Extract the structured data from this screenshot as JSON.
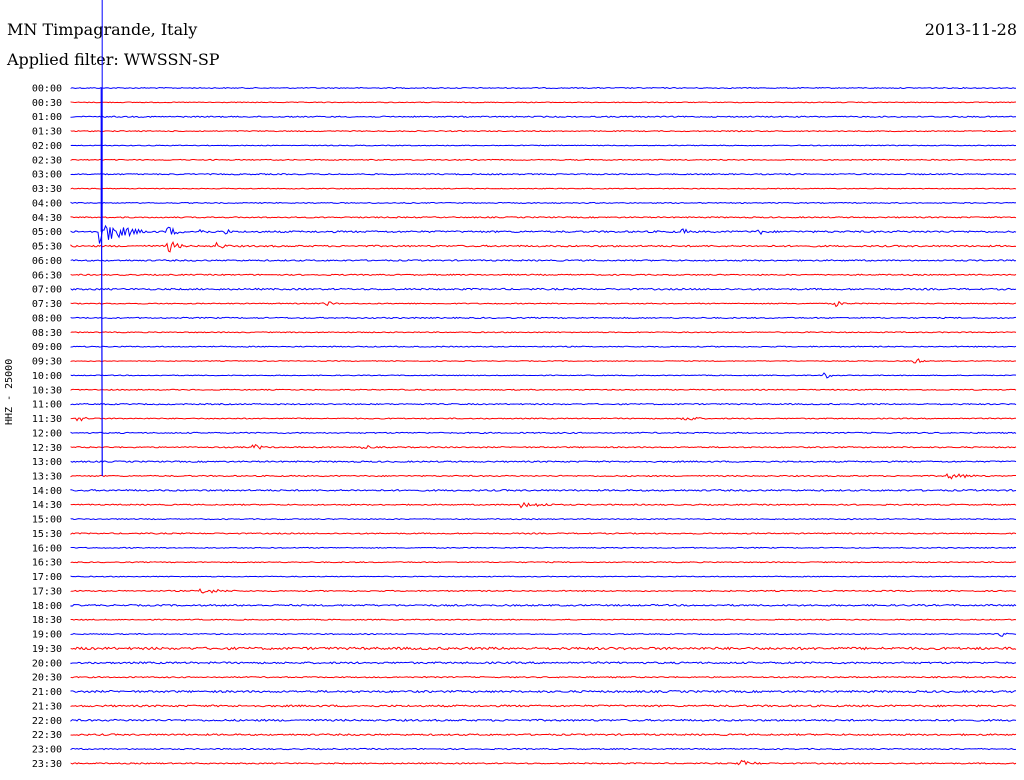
{
  "header": {
    "title": "MN Timpagrande, Italy",
    "date": "2013-11-28",
    "filter": "Applied filter: WWSSN-SP"
  },
  "colors": {
    "blue": "#0000ff",
    "red": "#ff0000",
    "text": "#000000"
  },
  "chart_data": {
    "type": "line",
    "title": "MN Timpagrande, Italy",
    "ylabel": "HHZ - 25000",
    "xlabel": "",
    "ylim": [
      "00:00",
      "23:30"
    ],
    "grid": false,
    "legend": "none",
    "row_labels": [
      "00:00",
      "00:30",
      "01:00",
      "01:30",
      "02:00",
      "02:30",
      "03:00",
      "03:30",
      "04:00",
      "04:30",
      "05:00",
      "05:30",
      "06:00",
      "06:30",
      "07:00",
      "07:30",
      "08:00",
      "08:30",
      "09:00",
      "09:30",
      "10:00",
      "10:30",
      "11:00",
      "11:30",
      "12:00",
      "12:30",
      "13:00",
      "13:30",
      "14:00",
      "14:30",
      "15:00",
      "15:30",
      "16:00",
      "16:30",
      "17:00",
      "17:30",
      "18:00",
      "18:30",
      "19:00",
      "19:30",
      "20:00",
      "20:30",
      "21:00",
      "21:30",
      "22:00",
      "22:30",
      "23:00",
      "23:30"
    ],
    "noise": [
      0.5,
      0.4,
      0.6,
      0.5,
      0.4,
      0.5,
      0.6,
      0.4,
      0.5,
      0.6,
      0.9,
      0.8,
      0.7,
      0.6,
      0.8,
      0.5,
      0.6,
      0.5,
      0.5,
      0.4,
      0.4,
      0.5,
      0.6,
      0.5,
      0.6,
      0.6,
      0.7,
      0.6,
      0.8,
      0.6,
      0.5,
      0.6,
      0.5,
      0.5,
      0.4,
      0.6,
      0.8,
      0.5,
      0.5,
      1.2,
      0.9,
      0.6,
      1.0,
      0.9,
      0.9,
      0.8,
      0.6,
      0.6
    ],
    "events": [
      {
        "row": 10,
        "x": 0.034,
        "amp": 12,
        "w": 0.05
      },
      {
        "row": 10,
        "x": 0.065,
        "amp": 5,
        "w": 0.01
      },
      {
        "row": 10,
        "x": 0.105,
        "amp": 5,
        "w": 0.02
      },
      {
        "row": 10,
        "x": 0.14,
        "amp": 4,
        "w": 0.01
      },
      {
        "row": 10,
        "x": 0.165,
        "amp": 3,
        "w": 0.01
      },
      {
        "row": 10,
        "x": 0.65,
        "amp": 3,
        "w": 0.01
      },
      {
        "row": 10,
        "x": 0.73,
        "amp": 3,
        "w": 0.01
      },
      {
        "row": 11,
        "x": 0.105,
        "amp": 6,
        "w": 0.02
      },
      {
        "row": 11,
        "x": 0.155,
        "amp": 4,
        "w": 0.02
      },
      {
        "row": 15,
        "x": 0.27,
        "amp": 3,
        "w": 0.02
      },
      {
        "row": 15,
        "x": 0.81,
        "amp": 3,
        "w": 0.02
      },
      {
        "row": 19,
        "x": 0.895,
        "amp": 4,
        "w": 0.01
      },
      {
        "row": 20,
        "x": 0.8,
        "amp": 3,
        "w": 0.01
      },
      {
        "row": 23,
        "x": 0.01,
        "amp": 3,
        "w": 0.02
      },
      {
        "row": 23,
        "x": 0.65,
        "amp": 3,
        "w": 0.03
      },
      {
        "row": 25,
        "x": 0.195,
        "amp": 3,
        "w": 0.02
      },
      {
        "row": 25,
        "x": 0.31,
        "amp": 3,
        "w": 0.02
      },
      {
        "row": 27,
        "x": 0.93,
        "amp": 3,
        "w": 0.06
      },
      {
        "row": 29,
        "x": 0.48,
        "amp": 3,
        "w": 0.06
      },
      {
        "row": 35,
        "x": 0.14,
        "amp": 3,
        "w": 0.05
      },
      {
        "row": 38,
        "x": 0.985,
        "amp": 3,
        "w": 0.01
      },
      {
        "row": 47,
        "x": 0.71,
        "amp": 3,
        "w": 0.04
      }
    ]
  }
}
